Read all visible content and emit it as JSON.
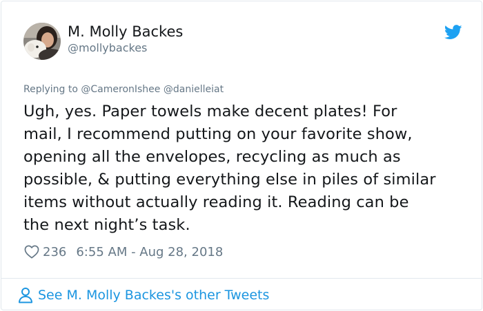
{
  "author": {
    "name": "M. Molly Backes",
    "handle": "@mollybackes"
  },
  "reply": {
    "prefix": "Replying to",
    "mentions": [
      "@CameronIshee",
      "@danielleiat"
    ]
  },
  "tweet": {
    "lines": [
      "Ugh, yes. Paper towels make decent plates! For",
      "mail, I recommend putting on your favorite show,",
      "opening all the envelopes, recycling as much as",
      "possible, & putting everything else in piles of similar",
      "items without actually reading it. Reading can be",
      "the next night’s task."
    ],
    "likes": "236",
    "timestamp": "6:55 AM - Aug 28, 2018"
  },
  "footer": {
    "link_label": "See M. Molly Backes's other Tweets"
  },
  "icons": {
    "brand": "twitter-bird-icon",
    "like": "heart-icon",
    "profile": "person-icon"
  },
  "colors": {
    "brand_blue": "#1da1f2",
    "link_blue": "#1b95e0",
    "secondary_text": "#657786",
    "primary_text": "#14171a",
    "border": "#e1e8ed"
  }
}
